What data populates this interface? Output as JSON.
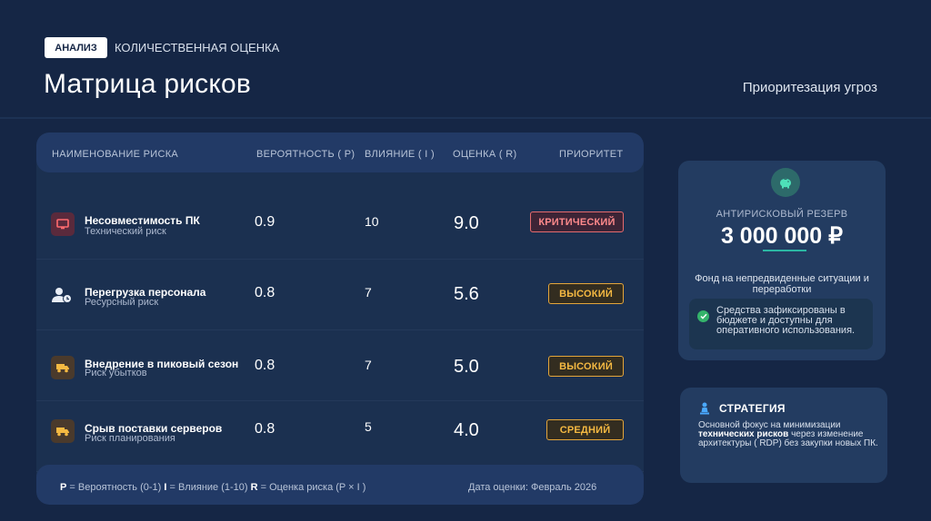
{
  "header": {
    "tag": "АНАЛИЗ",
    "subtag": "КОЛИЧЕСТВЕННАЯ ОЦЕНКА",
    "title": "Матрица рисков",
    "right_title": "Приоритезация угроз"
  },
  "table": {
    "columns": [
      "НАИМЕНОВАНИЕ РИСКА",
      "ВЕРОЯТНОСТЬ ( P)",
      "ВЛИЯНИЕ ( I )",
      "ОЦЕНКА ( R)",
      "ПРИОРИТЕТ"
    ],
    "rows": [
      {
        "name": "Несовместимость ПК",
        "type": "Технический риск",
        "probability": "0.9",
        "impact": "10",
        "score": "9.0",
        "priority": "КРИТИЧЕСКИЙ",
        "icon": "monitor-icon"
      },
      {
        "name": "Перегрузка персонала",
        "type": "Ресурсный риск",
        "probability": "0.8",
        "impact": "7",
        "score": "5.6",
        "priority": "ВЫСОКИЙ",
        "icon": "user-clock-icon"
      },
      {
        "name": "Внедрение в пиковый сезон",
        "type": "Риск убытков",
        "probability": "0.8",
        "impact": "7",
        "score": "5.0",
        "priority": "ВЫСОКИЙ",
        "icon": "truck-icon"
      },
      {
        "name": "Срыв поставки серверов",
        "type": "Риск планирования",
        "probability": "0.8",
        "impact": "5",
        "score": "4.0",
        "priority": "СРЕДНИЙ",
        "icon": "truck-icon"
      }
    ],
    "footer": {
      "legend_p": "P",
      "legend_p_text": " = Вероятность (0-1) ",
      "legend_i": "I",
      "legend_i_text": " = Влияние (1-10) ",
      "legend_r": "R",
      "legend_r_text": " = Оценка риска (P × I )",
      "date": "Дата оценки: Февраль 2026"
    }
  },
  "reserve": {
    "icon": "piggy-bank-icon",
    "label": "АНТИРИСКОВЫЙ РЕЗЕРВ",
    "value": "3 000 000 ₽",
    "description": "Фонд на непредвиденные ситуации и переработки",
    "note": "Средства зафиксированы в бюджете и доступны для оперативного использования."
  },
  "strategy": {
    "icon": "chess-pawn-icon",
    "title": "СТРАТЕГИЯ",
    "text_before": "Основной фокус на минимизации ",
    "text_bold": "технических рисков",
    "text_after": " через изменение архитектуры ( RDP)  без закупки новых ПК."
  },
  "colors": {
    "background": "#152645",
    "critical": "#ff8a8c",
    "high": "#f5b942",
    "accent": "#2bb6a3"
  }
}
